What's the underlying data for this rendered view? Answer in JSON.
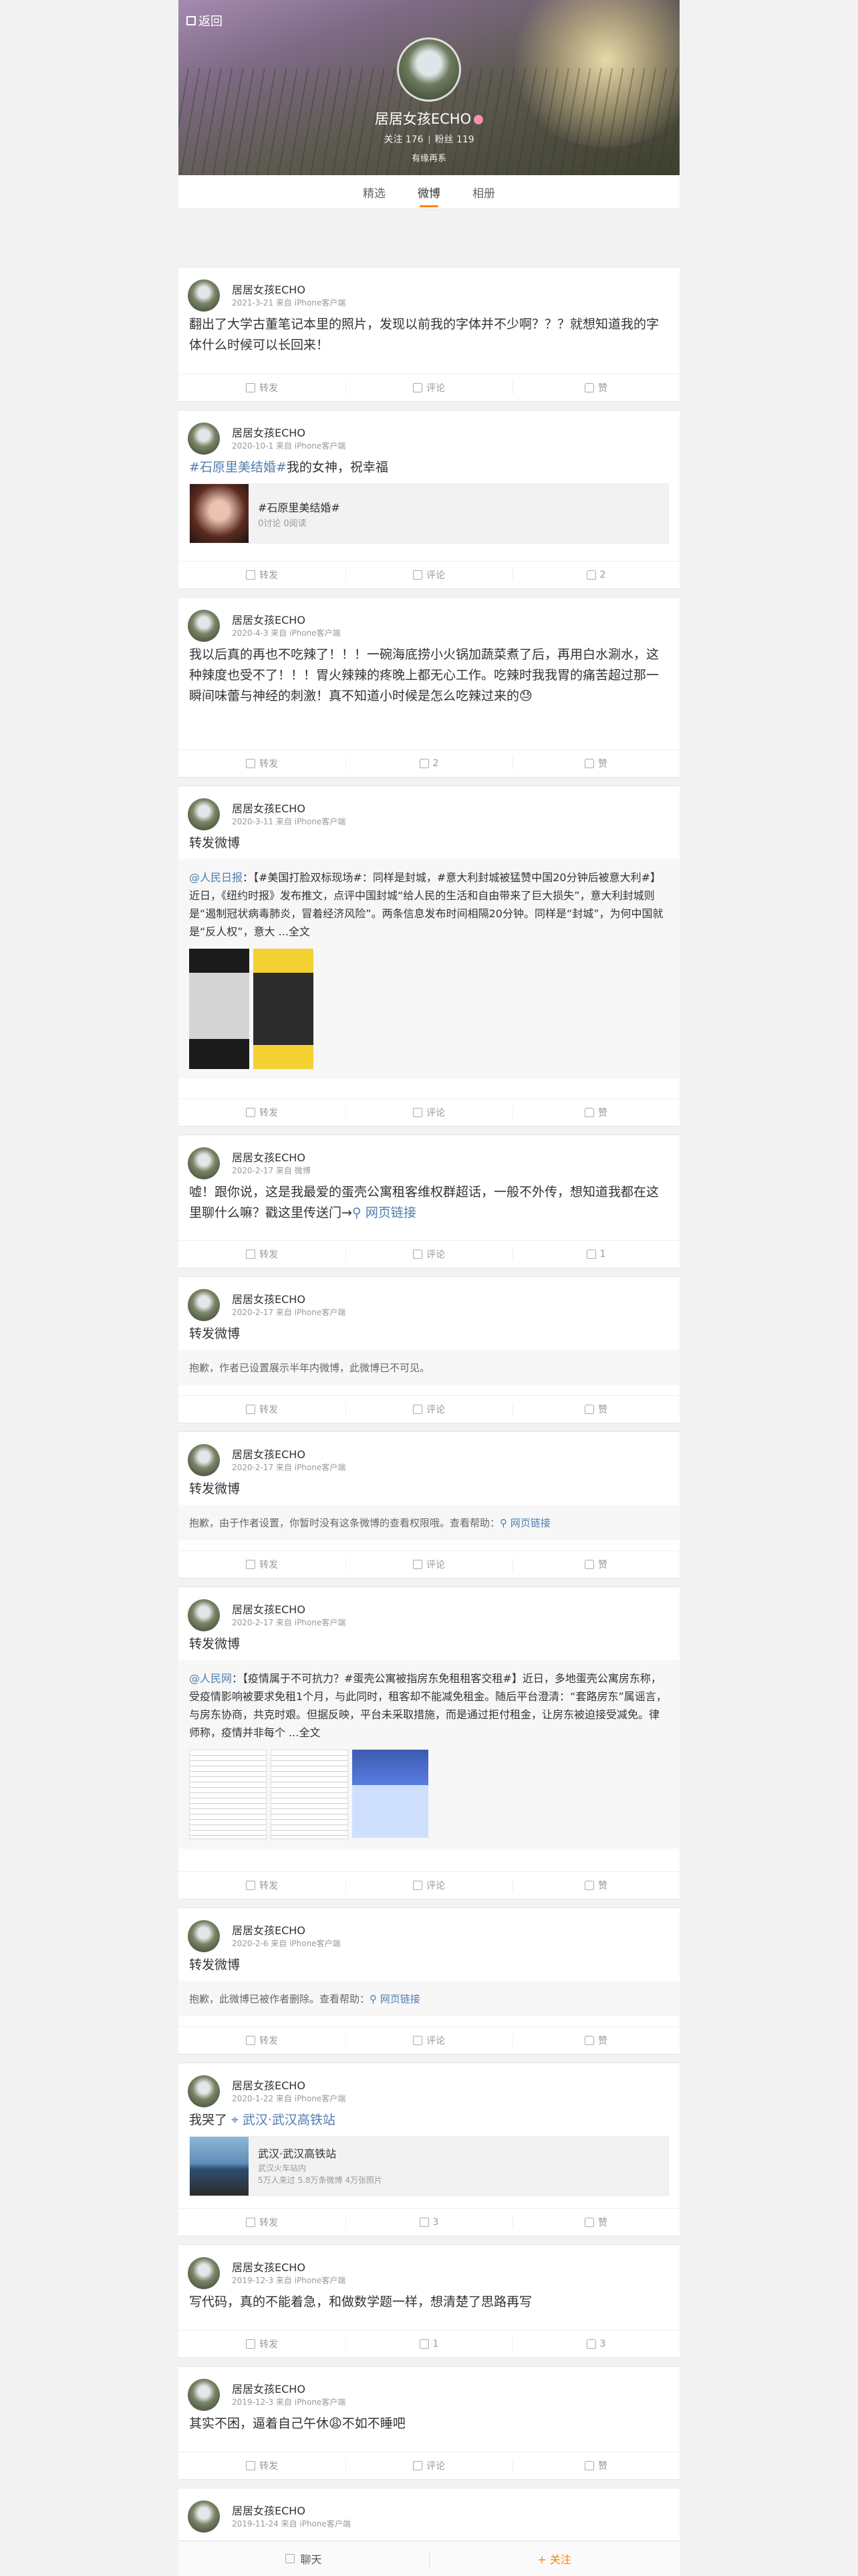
{
  "header": {
    "back_label": "返回",
    "nickname": "居居女孩ECHO",
    "stats": "关注 176  粉丝 119",
    "follow_count": "关注 176",
    "fans_count": "粉丝 119",
    "bio": "有缘再系"
  },
  "tabs": [
    "精选",
    "微博",
    "相册"
  ],
  "active_tab": "微博",
  "posts": [
    {
      "name": "居居女孩ECHO",
      "meta": "2021-3-21 来自 iPhone客户端",
      "text": "翻出了大学古董笔记本里的照片，发现以前我的字体并不少啊？？？就想知道我的字体什么时候可以长回来！",
      "repost": "转发",
      "comment": "评论",
      "like": "赞"
    },
    {
      "name": "居居女孩ECHO",
      "meta": "2020-10-1 来自 iPhone客户端",
      "tag": "#石原里美结婚#",
      "text_rest": "我的女神，祝幸福",
      "card_title": "#石原里美结婚#",
      "card_sub": "0讨论 0阅读",
      "repost": "转发",
      "comment": "评论",
      "like": "2"
    },
    {
      "name": "居居女孩ECHO",
      "meta": "2020-4-3 来自 iPhone客户端",
      "text": "我以后真的再也不吃辣了！！！一碗海底捞小火锅加蔬菜煮了后，再用白水涮水，这种辣度也受不了！！！胃火辣辣的疼晚上都无心工作。吃辣时我我胃的痛苦超过那一瞬间味蕾与神经的刺激！真不知道小时候是怎么吃辣过来的😓",
      "repost": "转发",
      "comment": "2",
      "like": "赞"
    },
    {
      "name": "居居女孩ECHO",
      "meta": "2020-3-11 来自 iPhone客户端",
      "text": "转发微博",
      "repost_at": "@人民日报",
      "repost_text": "：【#美国打脸双标现场#：同样是封城，#意大利封城被猛赞中国20分钟后被意大利#】近日，《纽约时报》发布推文，点评中国封城“给人民的生活和自由带来了巨大损失”，意大利封城则是“遏制冠状病毒肺炎，冒着经济风险”。两条信息发布时间相隔20分钟。同样是“封城”，为何中国就是“反人权”，意大 ...全文",
      "repost": "转发",
      "comment": "评论",
      "like": "赞"
    },
    {
      "name": "居居女孩ECHO",
      "meta": "2020-2-17 来自 微博",
      "text": "嘘！跟你说，这是我最爱的蛋壳公寓租客维权群超话，一般不外传，想知道我都在这里聊什么嘛？戳这里传送门→",
      "link": "网页链接",
      "repost": "转发",
      "comment": "评论",
      "like": "1"
    },
    {
      "name": "居居女孩ECHO",
      "meta": "2020-2-17 来自 iPhone客户端",
      "text": "转发微博",
      "notice": "抱歉，作者已设置展示半年内微博，此微博已不可见。",
      "repost": "转发",
      "comment": "评论",
      "like": "赞"
    },
    {
      "name": "居居女孩ECHO",
      "meta": "2020-2-17 来自 iPhone客户端",
      "text": "转发微博",
      "notice": "抱歉，由于作者设置，你暂时没有这条微博的查看权限哦。查看帮助：",
      "link": "网页链接",
      "repost": "转发",
      "comment": "评论",
      "like": "赞"
    },
    {
      "name": "居居女孩ECHO",
      "meta": "2020-2-17 来自 iPhone客户端",
      "text": "转发微博",
      "repost_at": "@人民网",
      "repost_text": "：【疫情属于不可抗力？#蛋壳公寓被指房东免租租客交租#】近日，多地蛋壳公寓房东称，受疫情影响被要求免租1个月，与此同时，租客却不能减免租金。随后平台澄清：“套路房东”属谣言，与房东协商，共克时艰。但据反映，平台未采取措施，而是通过拒付租金，让房东被迫接受减免。律师称，疫情并非每个 ...全文",
      "repost": "转发",
      "comment": "评论",
      "like": "赞"
    },
    {
      "name": "居居女孩ECHO",
      "meta": "2020-2-6 来自 iPhone客户端",
      "text": "转发微博",
      "notice": "抱歉，此微博已被作者删除。查看帮助：",
      "link": "网页链接",
      "repost": "转发",
      "comment": "评论",
      "like": "赞"
    },
    {
      "name": "居居女孩ECHO",
      "meta": "2020-1-22 来自 iPhone客户端",
      "text": "我哭了",
      "loc": "武汉·武汉高铁站",
      "place_title": "武汉·武汉高铁站",
      "place_sub": "武汉火车站内",
      "place_sub2": "5万人来过 5.8万条微博 4万张照片",
      "repost": "转发",
      "comment": "3",
      "like": "赞"
    },
    {
      "name": "居居女孩ECHO",
      "meta": "2019-12-3 来自 iPhone客户端",
      "text": "写代码，真的不能着急，和做数学题一样，想清楚了思路再写",
      "repost": "转发",
      "comment": "1",
      "like": "3"
    },
    {
      "name": "居居女孩ECHO",
      "meta": "2019-12-3 来自 iPhone客户端",
      "text": "其实不困，逼着自己午休😩不如不睡吧",
      "repost": "转发",
      "comment": "评论",
      "like": "赞"
    },
    {
      "name": "居居女孩ECHO",
      "meta": "2019-11-24 来自 iPhone客户端"
    }
  ],
  "bottom": {
    "chat": "聊天",
    "follow": "+ 关注"
  }
}
